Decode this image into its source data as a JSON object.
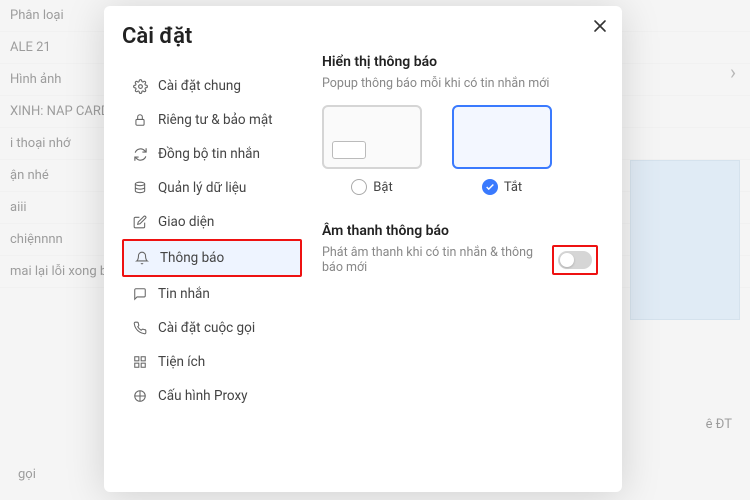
{
  "bg": {
    "rows": [
      "Phân loại",
      "ALE 21",
      "Hình ảnh",
      "XINH: NAP CARD KN",
      "i thoại nhớ",
      "ận nhé",
      "aiii",
      "chiệnnnn",
      "mai lại lỗi xong báo \"c",
      "ê ĐT",
      "gọi"
    ],
    "phan_loai": "Phân loại"
  },
  "modal": {
    "title": "Cài đặt",
    "menu": [
      {
        "icon": "gear",
        "label": "Cài đặt chung"
      },
      {
        "icon": "lock",
        "label": "Riêng tư & bảo mật"
      },
      {
        "icon": "sync",
        "label": "Đồng bộ tin nhắn"
      },
      {
        "icon": "database",
        "label": "Quản lý dữ liệu"
      },
      {
        "icon": "edit",
        "label": "Giao diện"
      },
      {
        "icon": "bell",
        "label": "Thông báo"
      },
      {
        "icon": "message",
        "label": "Tin nhắn"
      },
      {
        "icon": "phone",
        "label": "Cài đặt cuộc gọi"
      },
      {
        "icon": "grid",
        "label": "Tiện ích"
      },
      {
        "icon": "proxy",
        "label": "Cấu hình Proxy"
      }
    ]
  },
  "notify": {
    "display_title": "Hiển thị thông báo",
    "display_desc": "Popup thông báo mỗi khi có tin nhắn mới",
    "option_on": "Bật",
    "option_off": "Tắt",
    "sound_title": "Âm thanh thông báo",
    "sound_desc": "Phát âm thanh khi có tin nhắn & thông báo mới"
  }
}
